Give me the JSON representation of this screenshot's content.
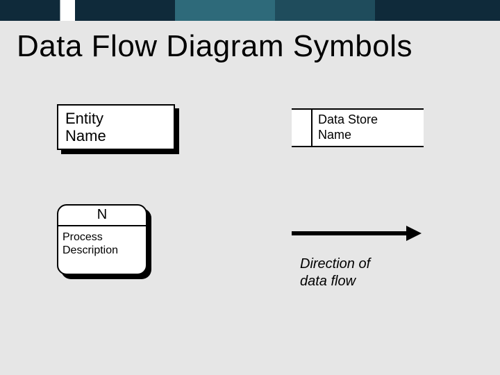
{
  "title": "Data Flow Diagram Symbols",
  "entity": {
    "label": "Entity\nName"
  },
  "datastore": {
    "label": "Data Store\nName"
  },
  "process": {
    "top": "N",
    "body": "Process\nDescription"
  },
  "arrow": {
    "caption": "Direction of\ndata flow"
  }
}
